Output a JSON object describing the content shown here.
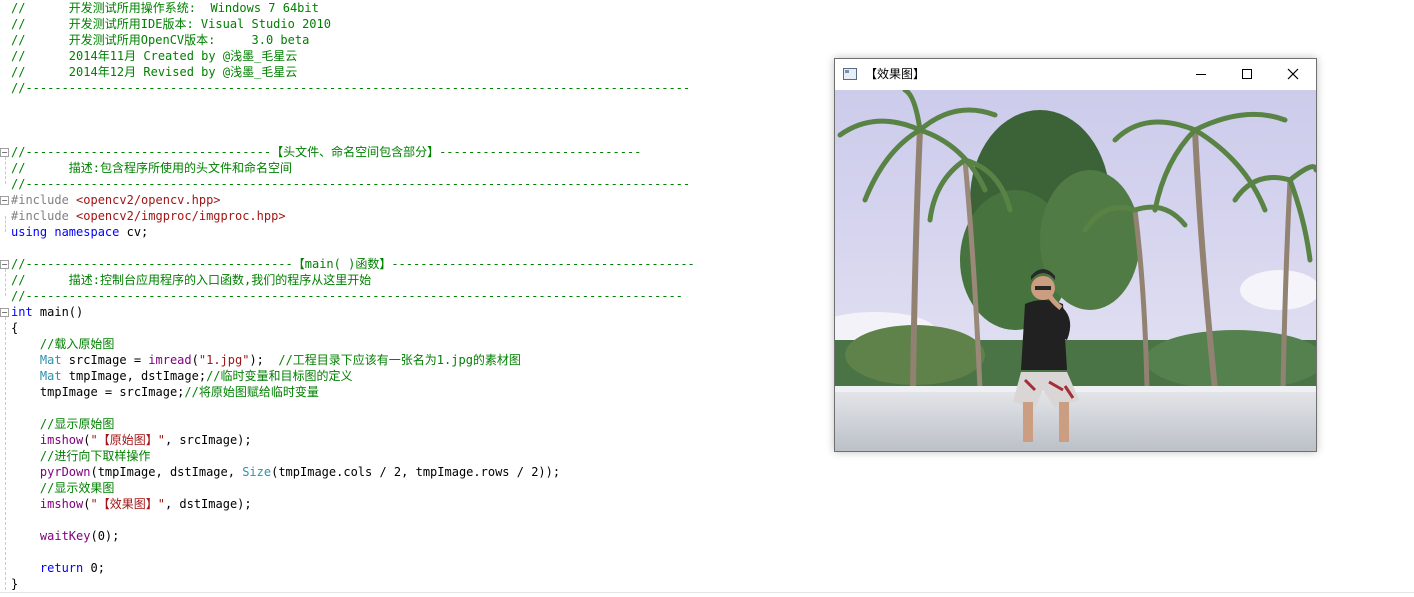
{
  "editor": {
    "lines": [
      [
        {
          "c": "c",
          "t": "//      开发测试所用操作系统:  Windows 7 64bit"
        }
      ],
      [
        {
          "c": "c",
          "t": "//      开发测试所用IDE版本: Visual Studio 2010"
        }
      ],
      [
        {
          "c": "c",
          "t": "//      开发测试所用OpenCV版本:     3.0 beta"
        }
      ],
      [
        {
          "c": "c",
          "t": "//      2014年11月 Created by @浅墨_毛星云"
        }
      ],
      [
        {
          "c": "c",
          "t": "//      2014年12月 Revised by @浅墨_毛星云"
        }
      ],
      [
        {
          "c": "c",
          "t": "//--------------------------------------------------------------------------------------------"
        }
      ],
      [],
      [],
      [],
      [
        {
          "c": "c",
          "t": "//----------------------------------【头文件、命名空间包含部分】----------------------------"
        }
      ],
      [
        {
          "c": "c",
          "t": "//      描述:包含程序所使用的头文件和命名空间"
        }
      ],
      [
        {
          "c": "c",
          "t": "//--------------------------------------------------------------------------------------------"
        }
      ],
      [
        {
          "c": "p",
          "t": "#include "
        },
        {
          "c": "s",
          "t": "<opencv2/opencv.hpp>"
        }
      ],
      [
        {
          "c": "p",
          "t": "#include "
        },
        {
          "c": "s",
          "t": "<opencv2/imgproc/imgproc.hpp>"
        }
      ],
      [
        {
          "c": "k",
          "t": "using namespace "
        },
        {
          "c": "",
          "t": "cv;"
        }
      ],
      [],
      [
        {
          "c": "c",
          "t": "//-------------------------------------【main( )函数】------------------------------------------"
        }
      ],
      [
        {
          "c": "c",
          "t": "//      描述:控制台应用程序的入口函数,我们的程序从这里开始"
        }
      ],
      [
        {
          "c": "c",
          "t": "//-------------------------------------------------------------------------------------------"
        }
      ],
      [
        {
          "c": "k",
          "t": "int "
        },
        {
          "c": "",
          "t": "main()"
        }
      ],
      [
        {
          "c": "",
          "t": "{"
        }
      ],
      [
        {
          "c": "c",
          "t": "    //载入原始图"
        }
      ],
      [
        {
          "c": "t",
          "t": "    Mat "
        },
        {
          "c": "",
          "t": "srcImage = "
        },
        {
          "c": "m",
          "t": "imread"
        },
        {
          "c": "",
          "t": "("
        },
        {
          "c": "s",
          "t": "\"1.jpg\""
        },
        {
          "c": "",
          "t": ");  "
        },
        {
          "c": "c",
          "t": "//工程目录下应该有一张名为1.jpg的素材图"
        }
      ],
      [
        {
          "c": "t",
          "t": "    Mat "
        },
        {
          "c": "",
          "t": "tmpImage, dstImage;"
        },
        {
          "c": "c",
          "t": "//临时变量和目标图的定义"
        }
      ],
      [
        {
          "c": "",
          "t": "    tmpImage = srcImage;"
        },
        {
          "c": "c",
          "t": "//将原始图赋给临时变量"
        }
      ],
      [],
      [
        {
          "c": "c",
          "t": "    //显示原始图"
        }
      ],
      [
        {
          "c": "m",
          "t": "    imshow"
        },
        {
          "c": "",
          "t": "("
        },
        {
          "c": "s",
          "t": "\"【原始图】\""
        },
        {
          "c": "",
          "t": ", srcImage);"
        }
      ],
      [
        {
          "c": "c",
          "t": "    //进行向下取样操作"
        }
      ],
      [
        {
          "c": "m",
          "t": "    pyrDown"
        },
        {
          "c": "",
          "t": "(tmpImage, dstImage, "
        },
        {
          "c": "t",
          "t": "Size"
        },
        {
          "c": "",
          "t": "(tmpImage.cols / 2, tmpImage.rows / 2));"
        }
      ],
      [
        {
          "c": "c",
          "t": "    //显示效果图"
        }
      ],
      [
        {
          "c": "m",
          "t": "    imshow"
        },
        {
          "c": "",
          "t": "("
        },
        {
          "c": "s",
          "t": "\"【效果图】\""
        },
        {
          "c": "",
          "t": ", dstImage);"
        }
      ],
      [],
      [
        {
          "c": "m",
          "t": "    waitKey"
        },
        {
          "c": "",
          "t": "(0);"
        }
      ],
      [],
      [
        {
          "c": "k",
          "t": "    return "
        },
        {
          "c": "",
          "t": "0;"
        }
      ],
      [
        {
          "c": "",
          "t": "}"
        }
      ]
    ],
    "fold_markers": [
      9,
      12,
      16,
      19
    ]
  },
  "window": {
    "title": "【效果图】",
    "minimize_icon": "minimize-icon",
    "maximize_icon": "maximize-icon",
    "close_icon": "close-icon",
    "image_description_icon": "photo-of-person-sitting-on-wall-with-palm-trees"
  },
  "colors": {
    "comment": "#008000",
    "keyword": "#0000ff",
    "type": "#2b91af",
    "string": "#a31515",
    "function": "#800080",
    "preprocessor": "#808080"
  }
}
